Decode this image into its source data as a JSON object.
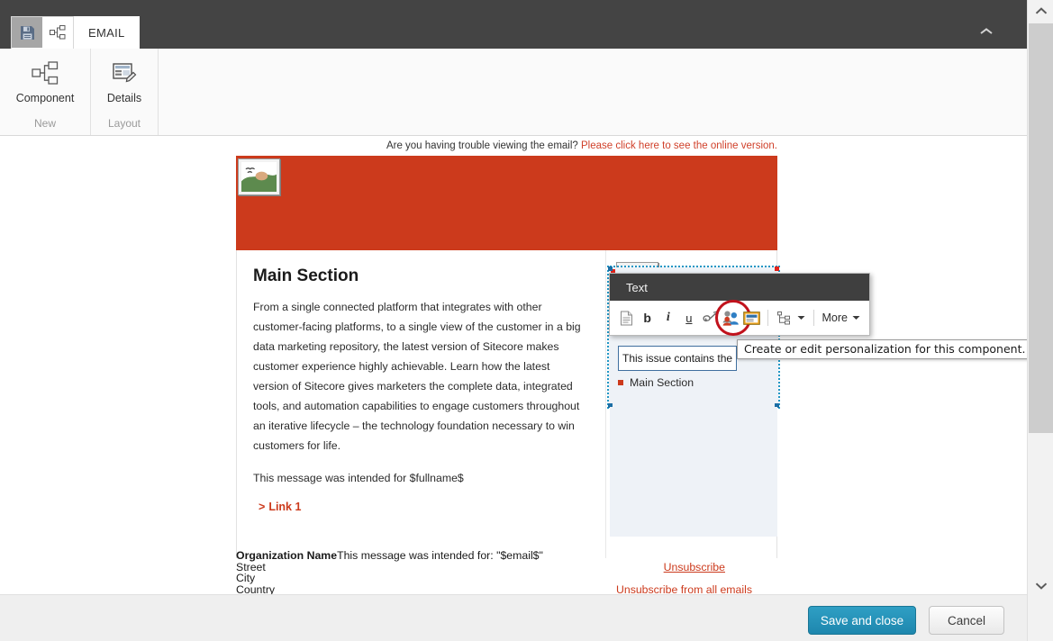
{
  "ribbon": {
    "quick_access": [
      {
        "name": "save-icon",
        "label": "Save"
      },
      {
        "name": "component-icon",
        "label": "Component"
      }
    ],
    "tabs": [
      {
        "label": "EMAIL"
      }
    ],
    "collapse_icon": "chevron-up-icon",
    "groups": [
      {
        "icon": "component-icon",
        "label": "Component",
        "group_label": "New"
      },
      {
        "icon": "details-icon",
        "label": "Details",
        "group_label": "Layout"
      }
    ]
  },
  "email": {
    "preheader": {
      "text": "Are you having trouble viewing the email? ",
      "link": "Please click here to see the online version."
    },
    "header": {
      "image_placeholder": "broken-image-icon",
      "background": "#cc3a1c"
    },
    "main": {
      "title": "Main Section",
      "body": "From a single connected platform that integrates with other customer-facing platforms, to a single view of the customer in a big data marketing repository, the latest version of Sitecore makes customer experience highly achievable. Learn how the latest version of Sitecore gives marketers the complete data, integrated tools, and automation capabilities to engage customers throughout an iterative lifecycle – the technology foundation necessary to win customers for life.",
      "intended": "This message was intended for $fullname$",
      "link_label": "Link 1",
      "link_chevron": ">"
    },
    "right_column": {
      "rte_chip": "This issue contains the ...",
      "bullet_item": "Main Section"
    },
    "footer": {
      "org": "Organization Name",
      "intended": "This message was intended for: \"$email$\"",
      "street": "Street",
      "city": "City",
      "country": "Country",
      "unsubscribe": "Unsubscribe",
      "unsubscribe_all": "Unsubscribe from all emails"
    }
  },
  "text_panel": {
    "title": "Text",
    "tools": [
      {
        "name": "page-icon",
        "glyph": "▤"
      },
      {
        "name": "bold-icon",
        "glyph": "b"
      },
      {
        "name": "italic-icon",
        "glyph": "i"
      },
      {
        "name": "underline-icon",
        "glyph": "u"
      },
      {
        "name": "link-icon",
        "glyph": ""
      },
      {
        "name": "personalization-icon",
        "glyph": ""
      },
      {
        "name": "insert-media-icon",
        "glyph": ""
      },
      {
        "name": "tree-icon",
        "glyph": ""
      }
    ],
    "more_label": "More"
  },
  "tooltip": {
    "text": "Create or edit personalization for this component."
  },
  "bottom_bar": {
    "save_label": "Save and close",
    "cancel_label": "Cancel"
  },
  "colors": {
    "brand_red": "#cc3a1c",
    "ribbon_dark": "#444444",
    "primary_button": "#1e87ae",
    "highlight_ring": "#c1121c",
    "selection_outline": "#2196c4"
  }
}
